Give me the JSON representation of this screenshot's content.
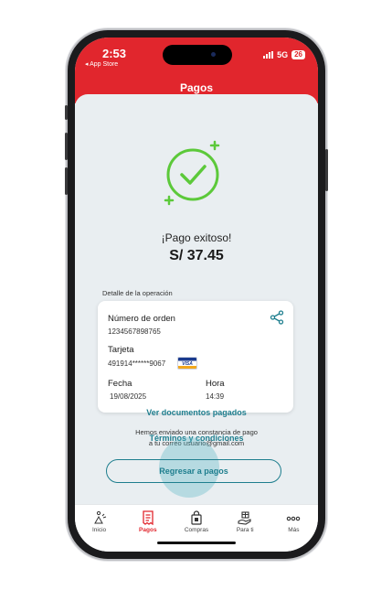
{
  "status": {
    "time": "2:53",
    "back_app": "◂ App Store",
    "network": "5G",
    "battery": "26"
  },
  "header": {
    "title": "Pagos"
  },
  "result": {
    "message": "¡Pago exitoso!",
    "amount": "S/ 37.45"
  },
  "details": {
    "section_title": "Detalle de la operación",
    "order_label": "Número de orden",
    "order_value": "1234567898765",
    "card_label": "Tarjeta",
    "card_value": "491914******9067",
    "card_brand": "VISA",
    "date_label": "Fecha",
    "date_value": "19/08/2025",
    "time_label": "Hora",
    "time_value": "14:39"
  },
  "links": {
    "documents": "Ver documentos pagados",
    "terms": "Términos y condiciones"
  },
  "notice": {
    "line1": "Hemos enviado una constancia de pago",
    "line2": "a tu correo usuario@gmail.com"
  },
  "actions": {
    "return_label": "Regresar a pagos"
  },
  "tabbar": {
    "items": [
      {
        "label": "Inicio",
        "icon": "home-icon"
      },
      {
        "label": "Pagos",
        "icon": "receipt-icon"
      },
      {
        "label": "Compras",
        "icon": "shopping-bag-icon"
      },
      {
        "label": "Para ti",
        "icon": "gift-hand-icon"
      },
      {
        "label": "Más",
        "icon": "more-icon"
      }
    ],
    "active": "Pagos"
  },
  "colors": {
    "brand_red": "#e1262d",
    "accent_teal": "#1e7e8e",
    "success_green": "#5cc93a"
  }
}
